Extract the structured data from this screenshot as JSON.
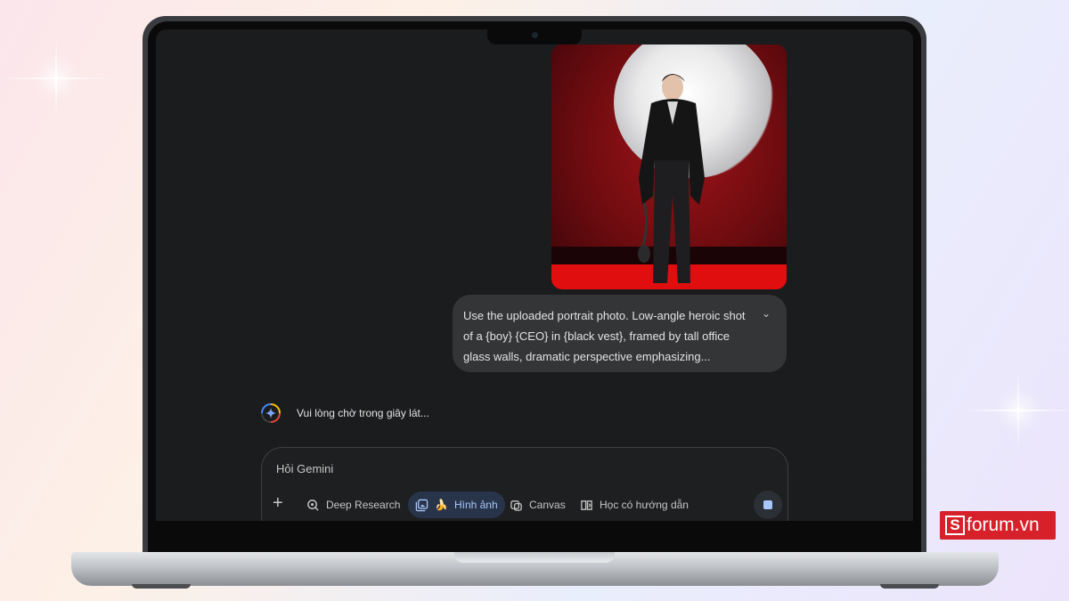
{
  "gemini": {
    "prompt_text": "Use the uploaded portrait photo. Low-angle heroic shot of a {boy} {CEO} in {black vest}, framed by tall office glass walls, dramatic perspective emphasizing...",
    "status": "Vui lòng chờ trong giây lát...",
    "input_placeholder": "Hỏi Gemini",
    "tools": {
      "deep_research": "Deep Research",
      "images": "Hình ảnh",
      "images_emoji": "🍌",
      "canvas": "Canvas",
      "guided_learning": "Học có hướng dẫn"
    }
  },
  "watermark": {
    "logo_letter": "S",
    "text": "forum.vn"
  },
  "colors": {
    "screen_bg": "#1b1c1d",
    "accent_blue": "#a8c7fa",
    "watermark_red": "#d6202a"
  }
}
